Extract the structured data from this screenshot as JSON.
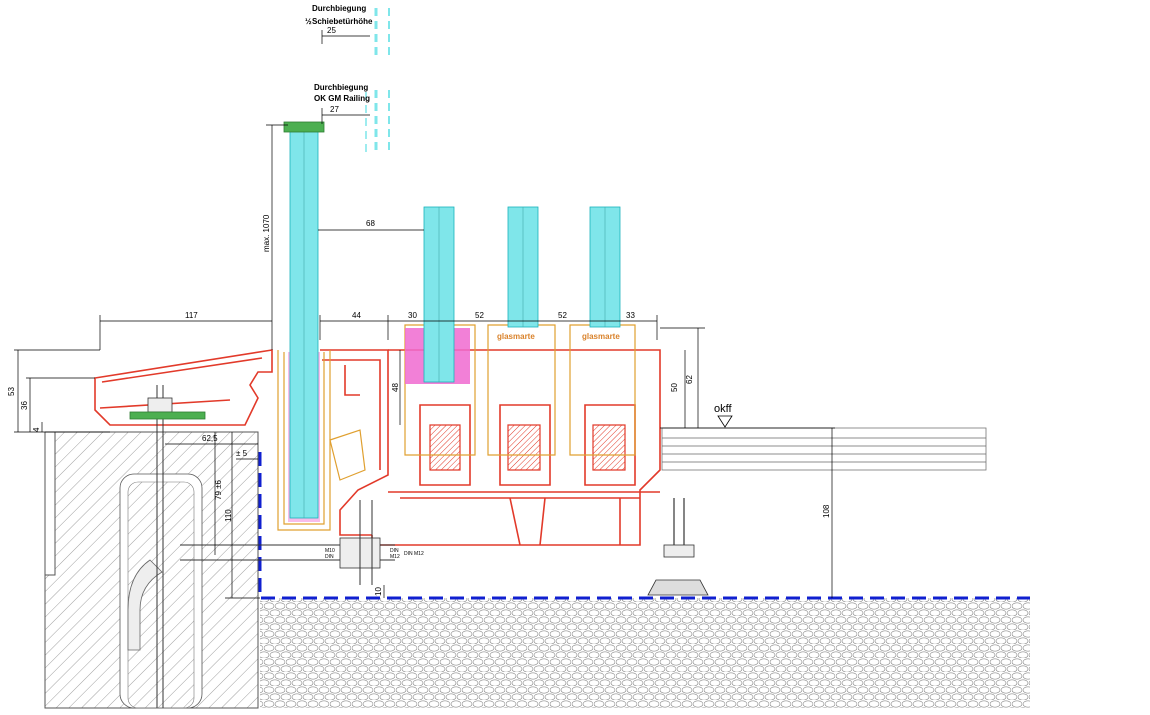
{
  "labels": {
    "durchbiegung_1": "Durchbiegung",
    "schiebe_fraction": "½",
    "schiebetuerhoehe": "Schiebetürhöhe",
    "durchbiegung_2": "Durchbiegung",
    "ok_gm_railing": "OK GM Railing",
    "brand_1": "glasmarte",
    "brand_2": "glasmarte",
    "okff": "okff",
    "bolt_left_1": "M10",
    "bolt_left_2": "DIN",
    "bolt_right_1": "DIN",
    "bolt_right_2": "M12",
    "bolt_right_3": "DIN M12"
  },
  "dimensions": {
    "d25": "25",
    "d27": "27",
    "d68": "68",
    "d117": "117",
    "d44": "44",
    "d30": "30",
    "d52a": "52",
    "d52b": "52",
    "d33": "33",
    "d53": "53",
    "d36": "36",
    "d4": "4",
    "d62_5": "62,5",
    "d5": "± 5",
    "d79": "79 ±6",
    "d110": "110",
    "d10": "10",
    "d48": "48",
    "d50": "50",
    "d62": "62",
    "d108": "108",
    "max1070": "max. 1070"
  },
  "colors": {
    "frame_red": "#e23a2a",
    "track_orange": "#e0a030",
    "glass_cyan": "#7fe6ea",
    "gasket_magenta": "#f06ad0",
    "seal_green": "#4caf50",
    "waterproof_blue": "#1020d0"
  }
}
